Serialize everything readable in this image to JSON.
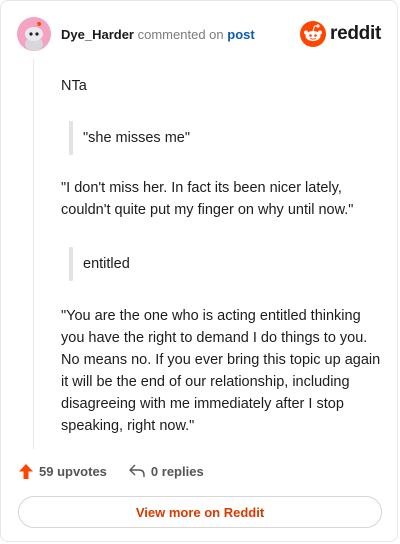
{
  "comment": {
    "username": "Dye_Harder",
    "action_text": "commented on",
    "post_link": "post",
    "blocks": [
      {
        "kind": "para",
        "text": "NTa"
      },
      {
        "kind": "quote",
        "text": "\"she misses me\""
      },
      {
        "kind": "para",
        "text": "\"I don't miss her. In fact its been nicer lately, couldn't quite put my finger on why until now.\""
      },
      {
        "kind": "quote",
        "text": "entitled"
      },
      {
        "kind": "para",
        "text": "\"You are the one who is acting entitled thinking you have the right to demand I do things to you. No means no. If you ever bring this topic up again it will be the end of our relationship, including disagreeing with me immediately after I stop speaking, right now.\""
      }
    ]
  },
  "brand": {
    "wordmark": "reddit",
    "color": "#ff4500",
    "icon": "reddit-logo-icon"
  },
  "footer": {
    "upvotes_label": "59 upvotes",
    "upvote_icon": "upvote-arrow-icon",
    "upvote_color": "#ff4500",
    "replies_label": "0 replies",
    "reply_icon": "reply-icon"
  },
  "cta": {
    "label": "View more on Reddit",
    "color": "#d93a00"
  },
  "avatar": {
    "icon": "snoo-avatar-icon",
    "bg_color": "#f5a3c3"
  }
}
